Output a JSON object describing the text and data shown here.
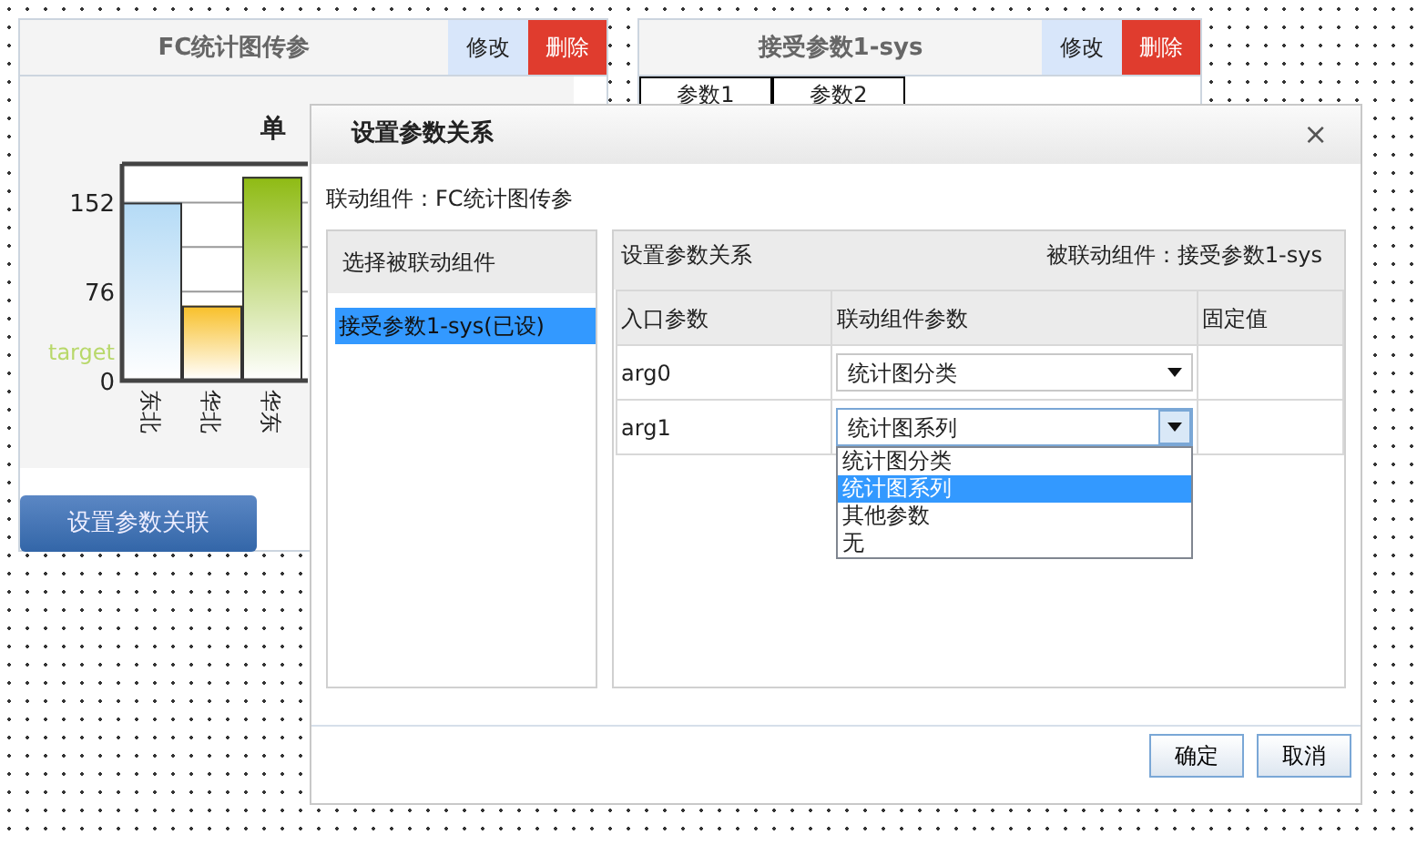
{
  "widgets": [
    {
      "title": "FC统计图传参",
      "edit_button": "修改",
      "delete_button": "删除",
      "chart_data": {
        "type": "bar",
        "title": "单",
        "categories": [
          "东北",
          "华北",
          "华东"
        ],
        "series": [
          {
            "values": [
              152,
              64,
              174
            ],
            "colors": [
              "#b5dbf6",
              "#f8c02a",
              "#8fbb14"
            ]
          }
        ],
        "ylim": [
          0,
          185
        ],
        "yticks": [
          0,
          76,
          152
        ],
        "annotations": [
          "target"
        ]
      },
      "action_button": "设置参数关联"
    },
    {
      "title": "接受参数1-sys",
      "edit_button": "修改",
      "delete_button": "删除",
      "tabs": [
        {
          "label": "参数1"
        },
        {
          "label": "参数2"
        }
      ]
    }
  ],
  "dialog": {
    "title": "设置参数关系",
    "close": "×",
    "linked_component": "联动组件：FC统计图传参",
    "left_panel": {
      "title": "选择被联动组件",
      "items": [
        {
          "label": "接受参数1-sys(已设)",
          "selected": true
        }
      ]
    },
    "right_panel": {
      "title": "设置参数关系",
      "target": "被联动组件：接受参数1-sys",
      "columns": [
        "入口参数",
        "联动组件参数",
        "固定值"
      ],
      "rows": [
        {
          "param": "arg0",
          "value": "统计图分类",
          "focused": false
        },
        {
          "param": "arg1",
          "value": "统计图系列",
          "focused": true,
          "expanded": true,
          "options": [
            {
              "label": "统计图分类",
              "selected": false
            },
            {
              "label": "统计图系列",
              "selected": true
            },
            {
              "label": "其他参数",
              "selected": false
            },
            {
              "label": "无",
              "selected": false
            }
          ]
        }
      ]
    },
    "buttons": [
      "确定",
      "取消"
    ]
  }
}
